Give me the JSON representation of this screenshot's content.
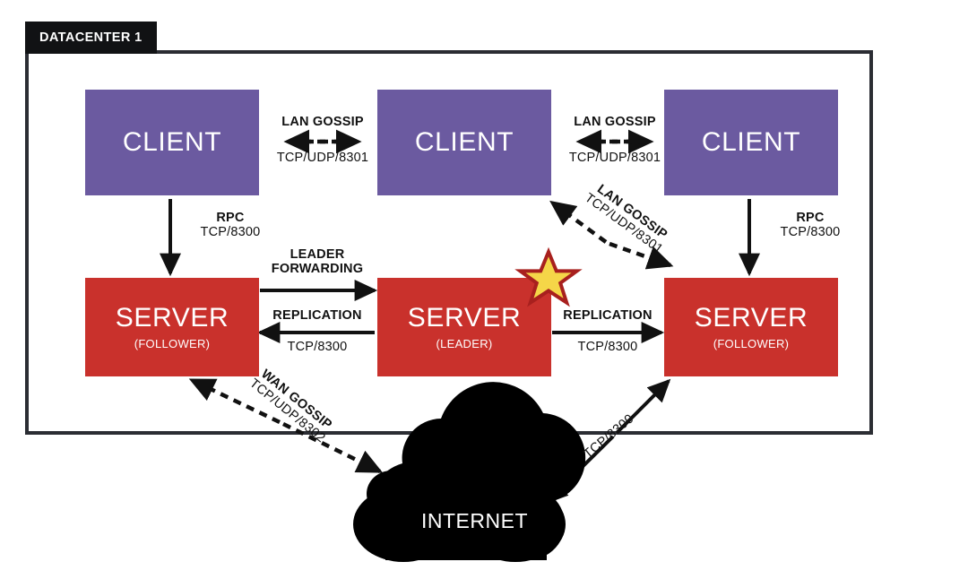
{
  "diagram": {
    "title": "DATACENTER 1",
    "colors": {
      "client": "#6b5aa0",
      "server": "#c9312c",
      "frame": "#2b2d33",
      "tab": "#111214",
      "star_fill": "#f5d648",
      "star_stroke": "#a8201e",
      "cloud": "#000000",
      "arrow": "#111111"
    }
  },
  "nodes": {
    "client_left": {
      "label": "CLIENT",
      "sub": ""
    },
    "client_center": {
      "label": "CLIENT",
      "sub": ""
    },
    "client_right": {
      "label": "CLIENT",
      "sub": ""
    },
    "server_left": {
      "label": "SERVER",
      "sub": "(FOLLOWER)"
    },
    "server_center": {
      "label": "SERVER",
      "sub": "(LEADER)"
    },
    "server_right": {
      "label": "SERVER",
      "sub": "(FOLLOWER)"
    },
    "internet": {
      "label": "INTERNET"
    }
  },
  "connections": {
    "lan_gossip_left": {
      "title": "LAN GOSSIP",
      "port": "TCP/UDP/8301",
      "style": "dashed",
      "direction": "bidirectional"
    },
    "lan_gossip_right": {
      "title": "LAN GOSSIP",
      "port": "TCP/UDP/8301",
      "style": "dashed",
      "direction": "bidirectional"
    },
    "lan_gossip_diag": {
      "title": "LAN GOSSIP",
      "port": "TCP/UDP/8301",
      "style": "dashed",
      "direction": "bidirectional"
    },
    "rpc_left": {
      "title": "RPC",
      "port": "TCP/8300",
      "style": "solid",
      "direction": "down"
    },
    "rpc_right": {
      "title": "RPC",
      "port": "TCP/8300",
      "style": "solid",
      "direction": "down"
    },
    "leader_forwarding": {
      "title": "LEADER FORWARDING",
      "title_line1": "LEADER",
      "title_line2": "FORWARDING",
      "port": "",
      "style": "solid",
      "direction": "right"
    },
    "replication_left": {
      "title": "REPLICATION",
      "port": "TCP/8300",
      "style": "solid",
      "direction": "left"
    },
    "replication_right": {
      "title": "REPLICATION",
      "port": "TCP/8300",
      "style": "solid",
      "direction": "right"
    },
    "wan_gossip": {
      "title": "WAN GOSSIP",
      "port": "TCP/UDP/8302",
      "style": "dashed",
      "direction": "bidirectional"
    },
    "internet_rpc": {
      "title": "",
      "port": "TCP/8300",
      "style": "solid",
      "direction": "bidirectional"
    }
  }
}
